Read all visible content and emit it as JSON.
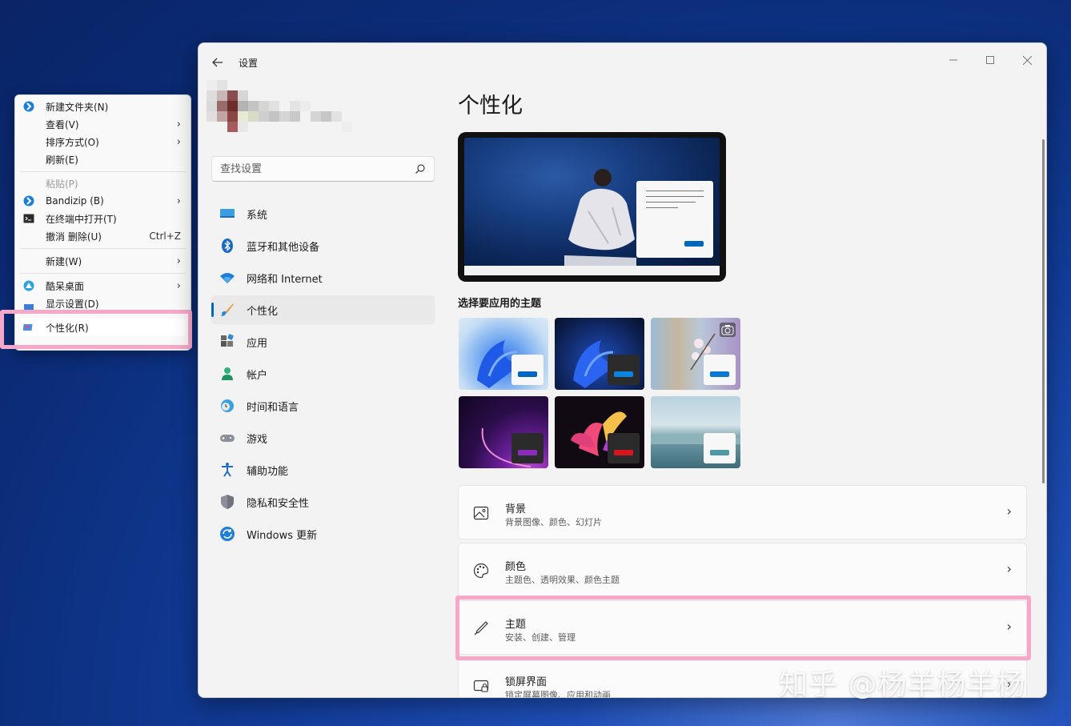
{
  "context_menu": {
    "items": [
      {
        "label": "新建文件夹(N)"
      },
      {
        "label": "查看(V)"
      },
      {
        "label": "排序方式(O)"
      },
      {
        "label": "刷新(E)"
      },
      {
        "label": "粘贴(P)"
      },
      {
        "label": "Bandizip (B)"
      },
      {
        "label": "在终端中打开(T)"
      },
      {
        "label": "撤消 删除(U)",
        "shortcut": "Ctrl+Z"
      },
      {
        "label": "新建(W)"
      },
      {
        "label": "酷呆桌面"
      },
      {
        "label": "显示设置(D)"
      },
      {
        "label": "个性化(R)"
      }
    ],
    "arrow": "›"
  },
  "settings": {
    "window_title": "设置",
    "search_placeholder": "查找设置",
    "nav": [
      {
        "label": "系统"
      },
      {
        "label": "蓝牙和其他设备"
      },
      {
        "label": "网络和 Internet"
      },
      {
        "label": "个性化"
      },
      {
        "label": "应用"
      },
      {
        "label": "帐户"
      },
      {
        "label": "时间和语言"
      },
      {
        "label": "游戏"
      },
      {
        "label": "辅助功能"
      },
      {
        "label": "隐私和安全性"
      },
      {
        "label": "Windows 更新"
      }
    ],
    "page_title": "个性化",
    "themes_label": "选择要应用的主题",
    "cards": [
      {
        "title": "背景",
        "subtitle": "背景图像、颜色、幻灯片"
      },
      {
        "title": "颜色",
        "subtitle": "主题色、透明效果、颜色主题"
      },
      {
        "title": "主题",
        "subtitle": "安装、创建、管理"
      },
      {
        "title": "锁屏界面",
        "subtitle": "锁定屏幕图像、应用和动画"
      }
    ],
    "chevron": "›",
    "accent_color": "#0067c0"
  },
  "watermark": "知乎 @杨羊杨羊杨"
}
